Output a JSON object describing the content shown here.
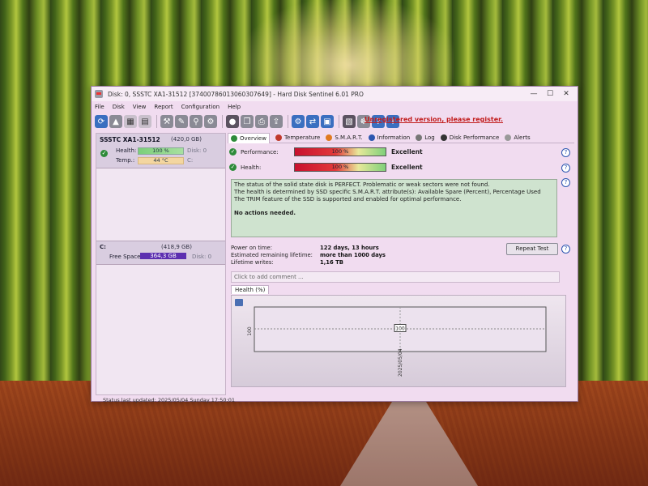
{
  "window": {
    "title": "Disk: 0, SSSTC  XA1-31512 [37400786013060307649]  -  Hard Disk Sentinel 6.01 PRO",
    "controls": {
      "minimize": "—",
      "maximize": "☐",
      "close": "✕"
    }
  },
  "menu": [
    "File",
    "Disk",
    "View",
    "Report",
    "Configuration",
    "Help"
  ],
  "unregistered_link": "Unregistered version, please register.",
  "disk_card": {
    "name": "SSSTC  XA1-31512",
    "size": "(420,0 GB)",
    "health_label": "Health:",
    "health_value": "100 %",
    "health_disk": "Disk: 0",
    "temp_label": "Temp.:",
    "temp_value": "44 °C",
    "temp_drive": "C:"
  },
  "volume": {
    "letter": "C:",
    "size": "(418,9 GB)",
    "free_label": "Free Space",
    "free_value": "364,3 GB",
    "disk": "Disk: 0"
  },
  "tabs": [
    {
      "label": "Overview",
      "icon": "check-icon",
      "color": "#2e8b3a"
    },
    {
      "label": "Temperature",
      "icon": "thermometer-icon",
      "color": "#c0392b"
    },
    {
      "label": "S.M.A.R.T.",
      "icon": "smart-icon",
      "color": "#555555"
    },
    {
      "label": "Information",
      "icon": "info-icon",
      "color": "#2c56b0"
    },
    {
      "label": "Log",
      "icon": "log-icon",
      "color": "#777777"
    },
    {
      "label": "Disk Performance",
      "icon": "speedometer-icon",
      "color": "#333333"
    },
    {
      "label": "Alerts",
      "icon": "alert-icon",
      "color": "#999999"
    }
  ],
  "performance": {
    "label": "Performance:",
    "value": "100 %",
    "status": "Excellent",
    "fraction": 1.0
  },
  "health": {
    "label": "Health:",
    "value": "100 %",
    "status": "Excellent",
    "fraction": 1.0
  },
  "status_text": [
    "The status of the solid state disk is PERFECT. Problematic or weak sectors were not found.",
    "The health is determined by SSD specific S.M.A.R.T. attribute(s):  Available Spare (Percent), Percentage Used",
    "The TRIM feature of the SSD is supported and enabled for optimal performance."
  ],
  "no_actions": "No actions needed.",
  "info": {
    "power_on_label": "Power on time:",
    "power_on_value": "122 days, 13 hours",
    "lifetime_label": "Estimated remaining lifetime:",
    "lifetime_value": "more than 1000 days",
    "writes_label": "Lifetime writes:",
    "writes_value": "1,16 TB"
  },
  "repeat_test": "Repeat Test",
  "comment_placeholder": "Click to add comment ...",
  "chart_tab": "Health (%)",
  "statusbar": "Status last updated: 2025/05/04 Sunday 17:50:01",
  "chart_data": {
    "type": "line",
    "title": "Health (%)",
    "x": [
      "2025/05/04"
    ],
    "series": [
      {
        "values": [
          100
        ]
      }
    ],
    "ytick": "100",
    "point_label": "100",
    "ylim": [
      0,
      200
    ]
  }
}
